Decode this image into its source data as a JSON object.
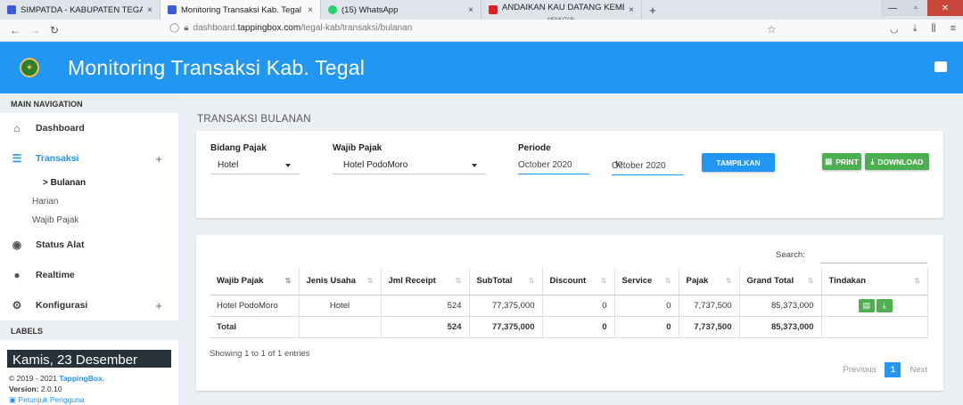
{
  "browser": {
    "tabs": [
      {
        "title": "SIMPATDA - KABUPATEN TEGAL",
        "close": "×",
        "color": "#3b5bdb"
      },
      {
        "title": "Monitoring Transaksi Kab. Tegal",
        "close": "×",
        "color": "#3b5bdb"
      },
      {
        "title": "(15) WhatsApp",
        "close": "×",
        "color": "#25d366"
      },
      {
        "title": "ANDAIKAN KAU DATANG KEMBALI",
        "subtitle": "MEMUTAR",
        "close": "×",
        "color": "#e02020"
      }
    ],
    "url_prefix": "dashboard.",
    "url_domain": "tappingbox.com",
    "url_path": "/tegal-kab/transaksi/bulanan"
  },
  "app": {
    "title": "Monitoring Transaksi Kab. Tegal",
    "brand_color": "#2196f3"
  },
  "sidebar": {
    "main_nav_label": "MAIN NAVIGATION",
    "dashboard": "Dashboard",
    "transaksi": "Transaksi",
    "transaksi_sub": {
      "bulanan": "> Bulanan",
      "harian": "Harian",
      "wajib_pajak": "Wajib Pajak"
    },
    "status_alat": "Status Alat",
    "realtime": "Realtime",
    "konfigurasi": "Konfigurasi",
    "plus": "+",
    "labels_label": "LABELS",
    "date_band": "Kamis, 23 Desember",
    "copyright_prefix": "© 2019 - 2021 ",
    "copyright_brand": "TappingBox.",
    "version_label": "Version:",
    "version_value": "2.0.10",
    "guide_link": "Petunjuk Pengguna"
  },
  "page": {
    "title": "TRANSAKSI BULANAN"
  },
  "filters": {
    "bidang_pajak_label": "Bidang Pajak",
    "bidang_pajak_value": "Hotel",
    "wajib_pajak_label": "Wajib Pajak",
    "wajib_pajak_value": "Hotel PodoMoro",
    "periode_label": "Periode",
    "periode_from": "October 2020",
    "periode_to_label": "to",
    "periode_to": "October 2020",
    "tampilkan": "TAMPILKAN",
    "print": "PRINT",
    "download": "DOWNLOAD"
  },
  "table": {
    "search_label": "Search:",
    "columns": [
      "Wajib Pajak",
      "Jenis Usaha",
      "Jml Receipt",
      "SubTotal",
      "Discount",
      "Service",
      "Pajak",
      "Grand Total",
      "Tindakan"
    ],
    "row": {
      "wajib_pajak": "Hotel PodoMoro",
      "jenis_usaha": "Hotel",
      "jml_receipt": "524",
      "subtotal": "77,375,000",
      "discount": "0",
      "service": "0",
      "pajak": "7,737,500",
      "grand_total": "85,373,000"
    },
    "total": {
      "label": "Total",
      "jml_receipt": "524",
      "subtotal": "77,375,000",
      "discount": "0",
      "service": "0",
      "pajak": "7,737,500",
      "grand_total": "85,373,000"
    },
    "showing": "Showing 1 to 1 of 1 entries",
    "pager": {
      "previous": "Previous",
      "page": "1",
      "next": "Next"
    }
  }
}
